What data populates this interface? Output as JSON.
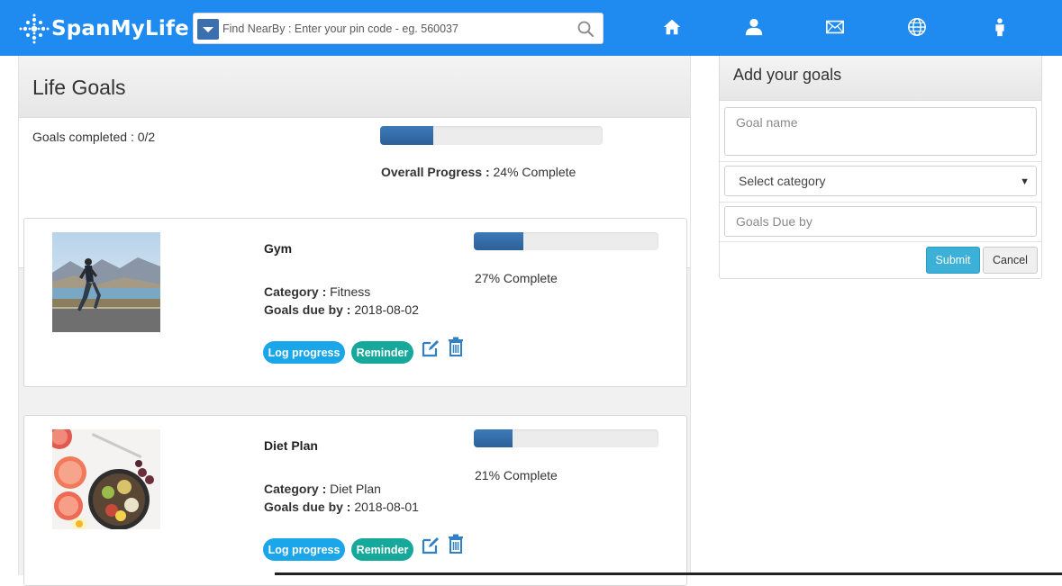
{
  "header": {
    "brand": "SpanMyLife",
    "search": {
      "placeholder": "Find NearBy : Enter your pin code - eg. 560037"
    },
    "nav_icons": [
      "home-icon",
      "user-icon",
      "mail-icon",
      "globe-icon",
      "person-icon"
    ]
  },
  "life_goals": {
    "title": "Life Goals",
    "goals_completed": "Goals completed : 0/2",
    "overall": {
      "label": "Overall Progress :",
      "text": "24% Complete",
      "progress": 0.24
    }
  },
  "goals": [
    {
      "name": "Gym",
      "category_label": "Category :",
      "category": "Fitness",
      "due_label": "Goals due by :",
      "due": "2018-08-02",
      "progress": 0.27,
      "progress_text": "27% Complete",
      "log_label": "Log progress",
      "reminder_label": "Reminder"
    },
    {
      "name": "Diet Plan",
      "category_label": "Category :",
      "category": "Diet Plan",
      "due_label": "Goals due by :",
      "due": "2018-08-01",
      "progress": 0.21,
      "progress_text": "21% Complete",
      "log_label": "Log progress",
      "reminder_label": "Reminder"
    }
  ],
  "add_goals": {
    "title": "Add your goals",
    "goal_name_placeholder": "Goal name",
    "category_selected": "Select category",
    "due_placeholder": "Goals Due by",
    "submit_label": "Submit",
    "cancel_label": "Cancel"
  },
  "colors": {
    "topbar": "#1f8af0",
    "progress_fill": "#2c6099",
    "log_progress": "#1aa6e8",
    "reminder": "#16a89b",
    "submit": "#3cb0d7"
  }
}
